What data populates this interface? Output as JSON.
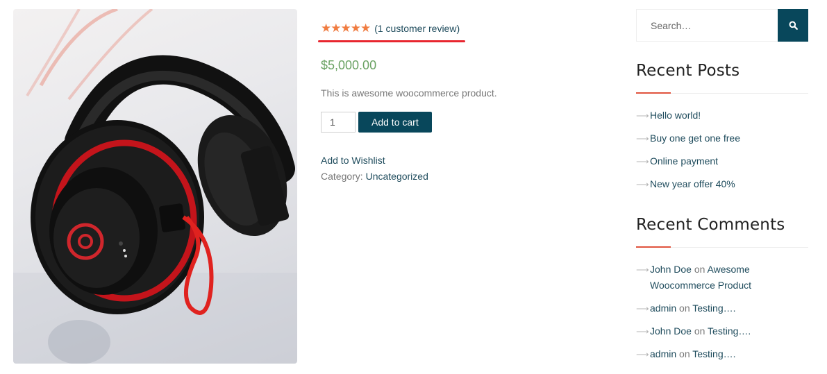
{
  "product": {
    "rating_stars": "★★★★★",
    "review_link": "(1 customer review)",
    "price": "$5,000.00",
    "short_description": "This is awesome woocommerce product.",
    "quantity_value": "1",
    "add_to_cart_label": "Add to cart",
    "wishlist_label": "Add to Wishlist",
    "category_label": "Category:",
    "category_value": "Uncategorized"
  },
  "sidebar": {
    "search_placeholder": "Search…",
    "recent_posts": {
      "title": "Recent Posts",
      "items": [
        "Hello world!",
        "Buy one get one free",
        "Online payment",
        "New year offer 40%"
      ]
    },
    "recent_comments": {
      "title": "Recent Comments",
      "items": [
        {
          "author": "John Doe",
          "on": "on",
          "post_line1": "Awesome",
          "post_line2": "Woocommerce Product"
        },
        {
          "author": "admin",
          "on": "on",
          "post": "Testing…."
        },
        {
          "author": "John Doe",
          "on": "on",
          "post": "Testing…."
        },
        {
          "author": "admin",
          "on": "on",
          "post": "Testing…."
        }
      ]
    }
  },
  "colors": {
    "star": "#f07c41",
    "price": "#6aa263",
    "button": "#08475b",
    "underline_annotation": "#e8262f",
    "widget_accent": "#e0533d",
    "link": "#1e4b5c"
  },
  "icons": {
    "search_button": "search-icon",
    "list_bullet": "arrow-right-icon"
  }
}
